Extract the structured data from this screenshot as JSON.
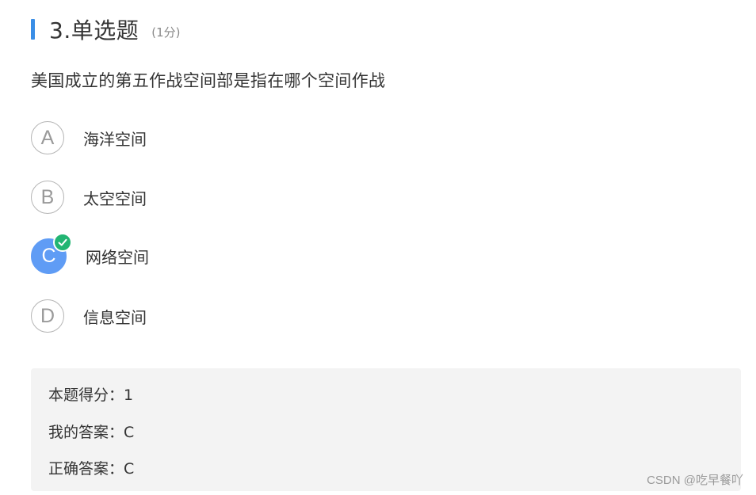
{
  "question": {
    "title": "3.单选题",
    "score": "(1分)",
    "text": "美国成立的第五作战空间部是指在哪个空间作战",
    "accent_color": "#3a8ee6"
  },
  "options": [
    {
      "letter": "A",
      "label": "海洋空间",
      "selected": false
    },
    {
      "letter": "B",
      "label": "太空空间",
      "selected": false
    },
    {
      "letter": "C",
      "label": "网络空间",
      "selected": true
    },
    {
      "letter": "D",
      "label": "信息空间",
      "selected": false
    }
  ],
  "result": {
    "score_line": "本题得分：1",
    "my_answer_line": "我的答案：C",
    "correct_answer_line": "正确答案：C"
  },
  "colors": {
    "selected_option": "#5f9cf5",
    "correct_check": "#22b573"
  },
  "icons": {
    "check": "check-circle-icon"
  },
  "watermark": "CSDN @吃早餐吖"
}
